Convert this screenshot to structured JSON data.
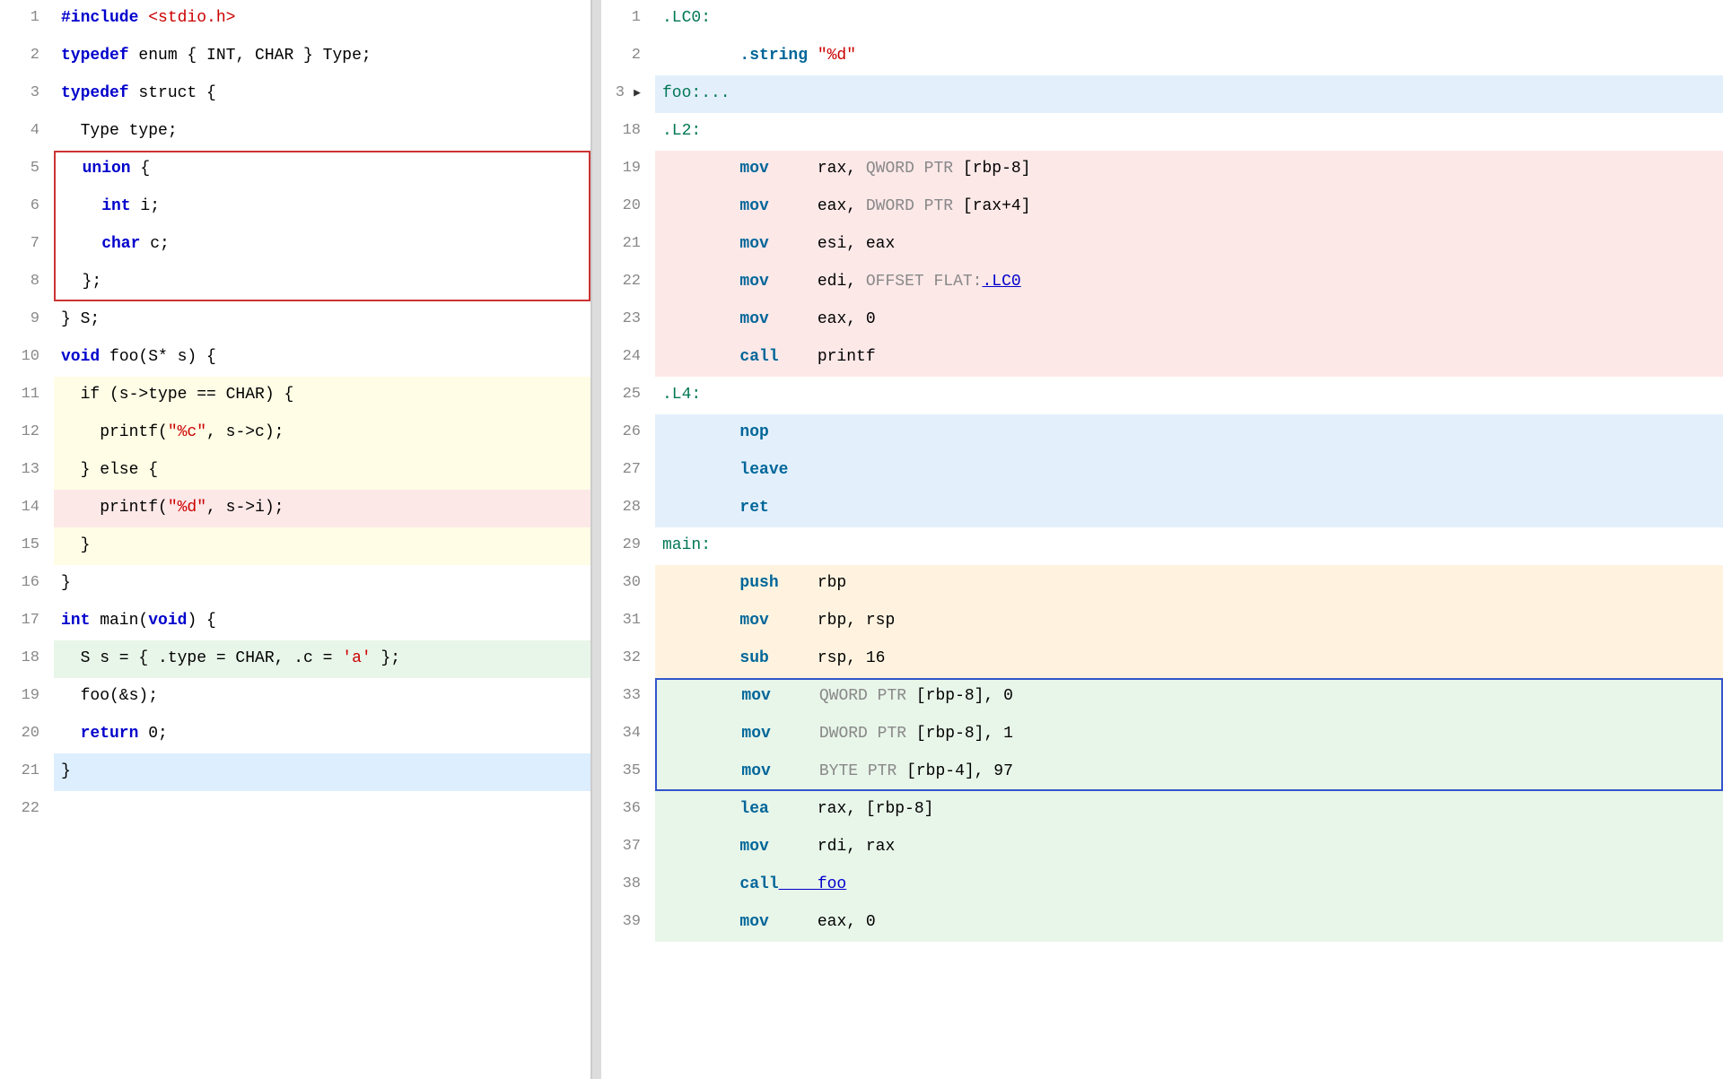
{
  "left": {
    "lines": [
      {
        "num": 1,
        "bg": "none",
        "tokens": [
          {
            "t": "kw",
            "v": "#include"
          },
          {
            "t": "str",
            "v": " <stdio.h>"
          }
        ]
      },
      {
        "num": 2,
        "bg": "none",
        "tokens": [
          {
            "t": "kw",
            "v": "typedef"
          },
          {
            "t": "ident",
            "v": " enum { INT, CHAR } Type;"
          }
        ]
      },
      {
        "num": 3,
        "bg": "none",
        "tokens": [
          {
            "t": "kw",
            "v": "typedef"
          },
          {
            "t": "ident",
            "v": " struct {"
          }
        ]
      },
      {
        "num": 4,
        "bg": "none",
        "tokens": [
          {
            "t": "ident",
            "v": "  Type type;"
          }
        ]
      },
      {
        "num": 5,
        "bg": "none",
        "tokens": [
          {
            "t": "kw",
            "v": "  union"
          },
          {
            "t": "ident",
            "v": " {"
          }
        ],
        "border_top_red": true
      },
      {
        "num": 6,
        "bg": "none",
        "tokens": [
          {
            "t": "kw",
            "v": "    int"
          },
          {
            "t": "ident",
            "v": " i;"
          }
        ],
        "border_mid_red": true
      },
      {
        "num": 7,
        "bg": "none",
        "tokens": [
          {
            "t": "kw",
            "v": "    char"
          },
          {
            "t": "ident",
            "v": " c;"
          }
        ],
        "border_mid_red": true
      },
      {
        "num": 8,
        "bg": "none",
        "tokens": [
          {
            "t": "ident",
            "v": "  };"
          }
        ],
        "border_bot_red": true
      },
      {
        "num": 9,
        "bg": "none",
        "tokens": [
          {
            "t": "ident",
            "v": "} S;"
          }
        ]
      },
      {
        "num": 10,
        "bg": "none",
        "tokens": [
          {
            "t": "kw",
            "v": "void"
          },
          {
            "t": "ident",
            "v": " foo(S* s) {"
          }
        ]
      },
      {
        "num": 11,
        "bg": "yellow",
        "tokens": [
          {
            "t": "ident",
            "v": "  if (s->type == CHAR) {"
          }
        ]
      },
      {
        "num": 12,
        "bg": "yellow",
        "tokens": [
          {
            "t": "ident",
            "v": "    printf("
          },
          {
            "t": "str",
            "v": "\"%c\""
          },
          {
            "t": "ident",
            "v": ", s->c);"
          }
        ]
      },
      {
        "num": 13,
        "bg": "yellow",
        "tokens": [
          {
            "t": "ident",
            "v": "  } else {"
          }
        ]
      },
      {
        "num": 14,
        "bg": "red",
        "tokens": [
          {
            "t": "ident",
            "v": "    printf("
          },
          {
            "t": "str",
            "v": "\"%d\""
          },
          {
            "t": "ident",
            "v": ", s->i);"
          }
        ]
      },
      {
        "num": 15,
        "bg": "yellow",
        "tokens": [
          {
            "t": "ident",
            "v": "  }"
          }
        ]
      },
      {
        "num": 16,
        "bg": "none",
        "tokens": [
          {
            "t": "ident",
            "v": "}"
          }
        ]
      },
      {
        "num": 17,
        "bg": "none",
        "tokens": [
          {
            "t": "kw",
            "v": "int"
          },
          {
            "t": "ident",
            "v": " main("
          },
          {
            "t": "kw",
            "v": "void"
          },
          {
            "t": "ident",
            "v": ") {"
          }
        ]
      },
      {
        "num": 18,
        "bg": "green",
        "tokens": [
          {
            "t": "ident",
            "v": "  S s = { .type = CHAR, .c = "
          },
          {
            "t": "str",
            "v": "'a'"
          },
          {
            "t": "ident",
            "v": " };"
          }
        ]
      },
      {
        "num": 19,
        "bg": "none",
        "tokens": [
          {
            "t": "ident",
            "v": "  foo(&s);"
          }
        ]
      },
      {
        "num": 20,
        "bg": "none",
        "tokens": [
          {
            "t": "kw",
            "v": "  return"
          },
          {
            "t": "ident",
            "v": " 0;"
          }
        ]
      },
      {
        "num": 21,
        "bg": "blue",
        "tokens": [
          {
            "t": "ident",
            "v": "}"
          }
        ]
      },
      {
        "num": 22,
        "bg": "none",
        "tokens": []
      }
    ]
  },
  "right": {
    "lines": [
      {
        "num": 1,
        "bg": "none",
        "label": true,
        "tokens": [
          {
            "t": "asm-label",
            "v": ".LC0:"
          }
        ]
      },
      {
        "num": 2,
        "bg": "none",
        "tokens": [
          {
            "t": "asm-instr",
            "v": "        .string "
          },
          {
            "t": "asm-str",
            "v": "\"%d\""
          }
        ]
      },
      {
        "num": 3,
        "bg": "blue-light",
        "expandable": true,
        "tokens": [
          {
            "t": "asm-label",
            "v": "foo:..."
          }
        ]
      },
      {
        "num": 18,
        "bg": "none",
        "label": true,
        "tokens": [
          {
            "t": "asm-label",
            "v": ".L2:"
          }
        ]
      },
      {
        "num": 19,
        "bg": "red",
        "tokens": [
          {
            "t": "asm-instr",
            "v": "        mov"
          },
          {
            "t": "asm-reg",
            "v": "     rax, "
          },
          {
            "t": "asm-kw",
            "v": "QWORD PTR "
          },
          {
            "t": "asm-reg",
            "v": "[rbp-8]"
          }
        ]
      },
      {
        "num": 20,
        "bg": "red",
        "tokens": [
          {
            "t": "asm-instr",
            "v": "        mov"
          },
          {
            "t": "asm-reg",
            "v": "     eax, "
          },
          {
            "t": "asm-kw",
            "v": "DWORD PTR "
          },
          {
            "t": "asm-reg",
            "v": "[rax+4]"
          }
        ]
      },
      {
        "num": 21,
        "bg": "red",
        "tokens": [
          {
            "t": "asm-instr",
            "v": "        mov"
          },
          {
            "t": "asm-reg",
            "v": "     esi, eax"
          }
        ]
      },
      {
        "num": 22,
        "bg": "red",
        "tokens": [
          {
            "t": "asm-instr",
            "v": "        mov"
          },
          {
            "t": "asm-reg",
            "v": "     edi, "
          },
          {
            "t": "asm-kw",
            "v": "OFFSET FLAT:"
          },
          {
            "t": "asm-link",
            "v": ".LC0"
          }
        ]
      },
      {
        "num": 23,
        "bg": "red",
        "tokens": [
          {
            "t": "asm-instr",
            "v": "        mov"
          },
          {
            "t": "asm-reg",
            "v": "     eax, 0"
          }
        ]
      },
      {
        "num": 24,
        "bg": "red",
        "tokens": [
          {
            "t": "asm-instr",
            "v": "        call"
          },
          {
            "t": "asm-reg",
            "v": "    printf"
          }
        ]
      },
      {
        "num": 25,
        "bg": "none",
        "label": true,
        "tokens": [
          {
            "t": "asm-label",
            "v": ".L4:"
          }
        ]
      },
      {
        "num": 26,
        "bg": "blue-light",
        "tokens": [
          {
            "t": "asm-instr",
            "v": "        nop"
          }
        ]
      },
      {
        "num": 27,
        "bg": "blue-light",
        "tokens": [
          {
            "t": "asm-instr",
            "v": "        leave"
          }
        ]
      },
      {
        "num": 28,
        "bg": "blue-light",
        "tokens": [
          {
            "t": "asm-instr",
            "v": "        ret"
          }
        ]
      },
      {
        "num": 29,
        "bg": "none",
        "label": true,
        "tokens": [
          {
            "t": "asm-label",
            "v": "main:"
          }
        ]
      },
      {
        "num": 30,
        "bg": "orange",
        "tokens": [
          {
            "t": "asm-instr",
            "v": "        push"
          },
          {
            "t": "asm-reg",
            "v": "    rbp"
          }
        ]
      },
      {
        "num": 31,
        "bg": "orange",
        "tokens": [
          {
            "t": "asm-instr",
            "v": "        mov"
          },
          {
            "t": "asm-reg",
            "v": "     rbp, rsp"
          }
        ]
      },
      {
        "num": 32,
        "bg": "orange",
        "tokens": [
          {
            "t": "asm-instr",
            "v": "        sub"
          },
          {
            "t": "asm-reg",
            "v": "     rsp, 16"
          }
        ]
      },
      {
        "num": 33,
        "bg": "green",
        "border_top_blue": true,
        "tokens": [
          {
            "t": "asm-instr",
            "v": "        mov"
          },
          {
            "t": "asm-reg",
            "v": "     "
          },
          {
            "t": "asm-kw",
            "v": "QWORD PTR "
          },
          {
            "t": "asm-reg",
            "v": "[rbp-8], 0"
          }
        ]
      },
      {
        "num": 34,
        "bg": "green",
        "border_mid_blue": true,
        "tokens": [
          {
            "t": "asm-instr",
            "v": "        mov"
          },
          {
            "t": "asm-reg",
            "v": "     "
          },
          {
            "t": "asm-kw",
            "v": "DWORD PTR "
          },
          {
            "t": "asm-reg",
            "v": "[rbp-8], 1"
          }
        ]
      },
      {
        "num": 35,
        "bg": "green",
        "border_bot_blue": true,
        "tokens": [
          {
            "t": "asm-instr",
            "v": "        mov"
          },
          {
            "t": "asm-reg",
            "v": "     "
          },
          {
            "t": "asm-kw",
            "v": "BYTE PTR "
          },
          {
            "t": "asm-reg",
            "v": "[rbp-4], 97"
          }
        ]
      },
      {
        "num": 36,
        "bg": "green",
        "tokens": [
          {
            "t": "asm-instr",
            "v": "        lea"
          },
          {
            "t": "asm-reg",
            "v": "     rax, [rbp-8]"
          }
        ]
      },
      {
        "num": 37,
        "bg": "green",
        "tokens": [
          {
            "t": "asm-instr",
            "v": "        mov"
          },
          {
            "t": "asm-reg",
            "v": "     rdi, rax"
          }
        ]
      },
      {
        "num": 38,
        "bg": "green",
        "tokens": [
          {
            "t": "asm-instr",
            "v": "        call"
          },
          {
            "t": "asm-link",
            "v": "    foo"
          }
        ]
      },
      {
        "num": 39,
        "bg": "green",
        "tokens": [
          {
            "t": "asm-instr",
            "v": "        mov"
          },
          {
            "t": "asm-reg",
            "v": "     eax, 0"
          }
        ]
      }
    ]
  },
  "colors": {
    "bg_yellow": "#fffde6",
    "bg_red": "#fde8e8",
    "bg_green": "#e8f5e9",
    "bg_blue": "#ddeeff",
    "bg_blue_light": "#e3f0fb",
    "bg_orange": "#fff3e0",
    "border_red": "#cc3333",
    "border_blue": "#3355cc"
  }
}
